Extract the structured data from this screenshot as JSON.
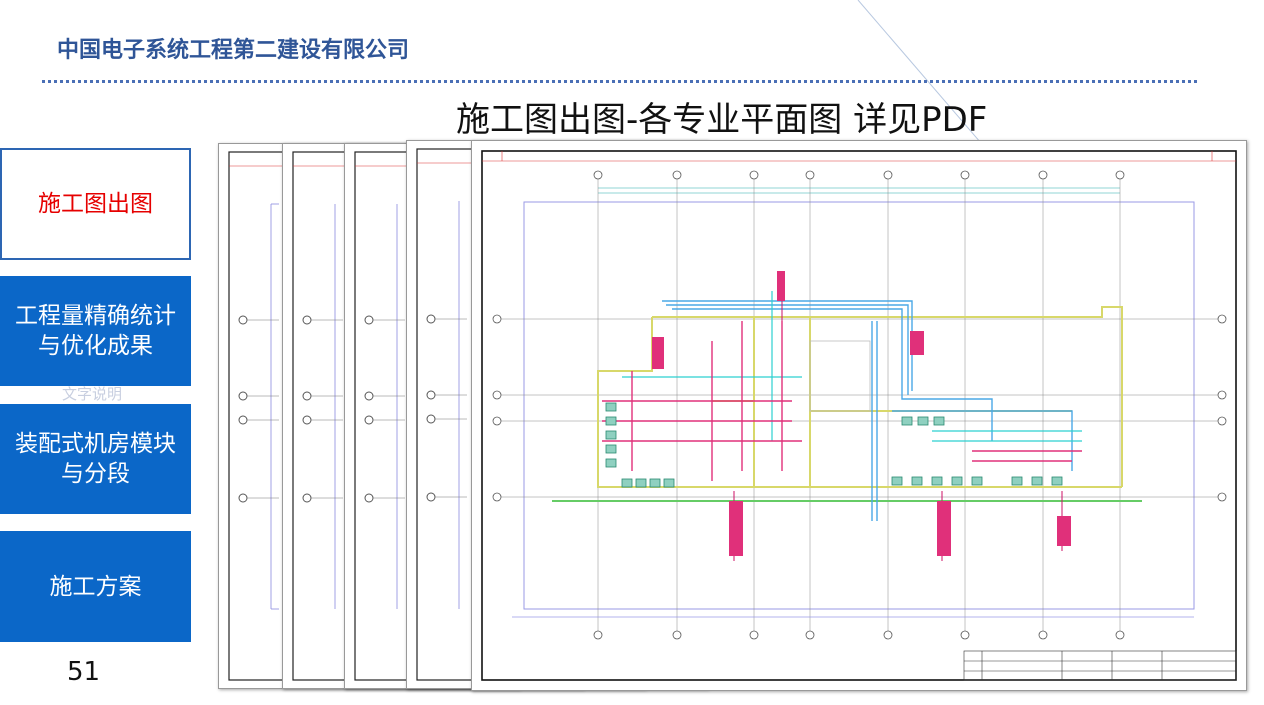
{
  "header": {
    "company": "中国电子系统工程第二建设有限公司"
  },
  "slide": {
    "title": "施工图出图-各专业平面图 详见PDF",
    "page_number": "51",
    "ghost_text": "文字说明"
  },
  "nav": {
    "items": [
      {
        "label": "施工图出图",
        "active": true
      },
      {
        "label": "工程量精确统计\n与优化成果",
        "active": false
      },
      {
        "label": "装配式机房模块\n与分段",
        "active": false
      },
      {
        "label": "施工方案",
        "active": false
      }
    ]
  },
  "colors": {
    "brand_blue": "#2f5597",
    "nav_blue": "#0b67c8",
    "active_text": "#e60000"
  }
}
